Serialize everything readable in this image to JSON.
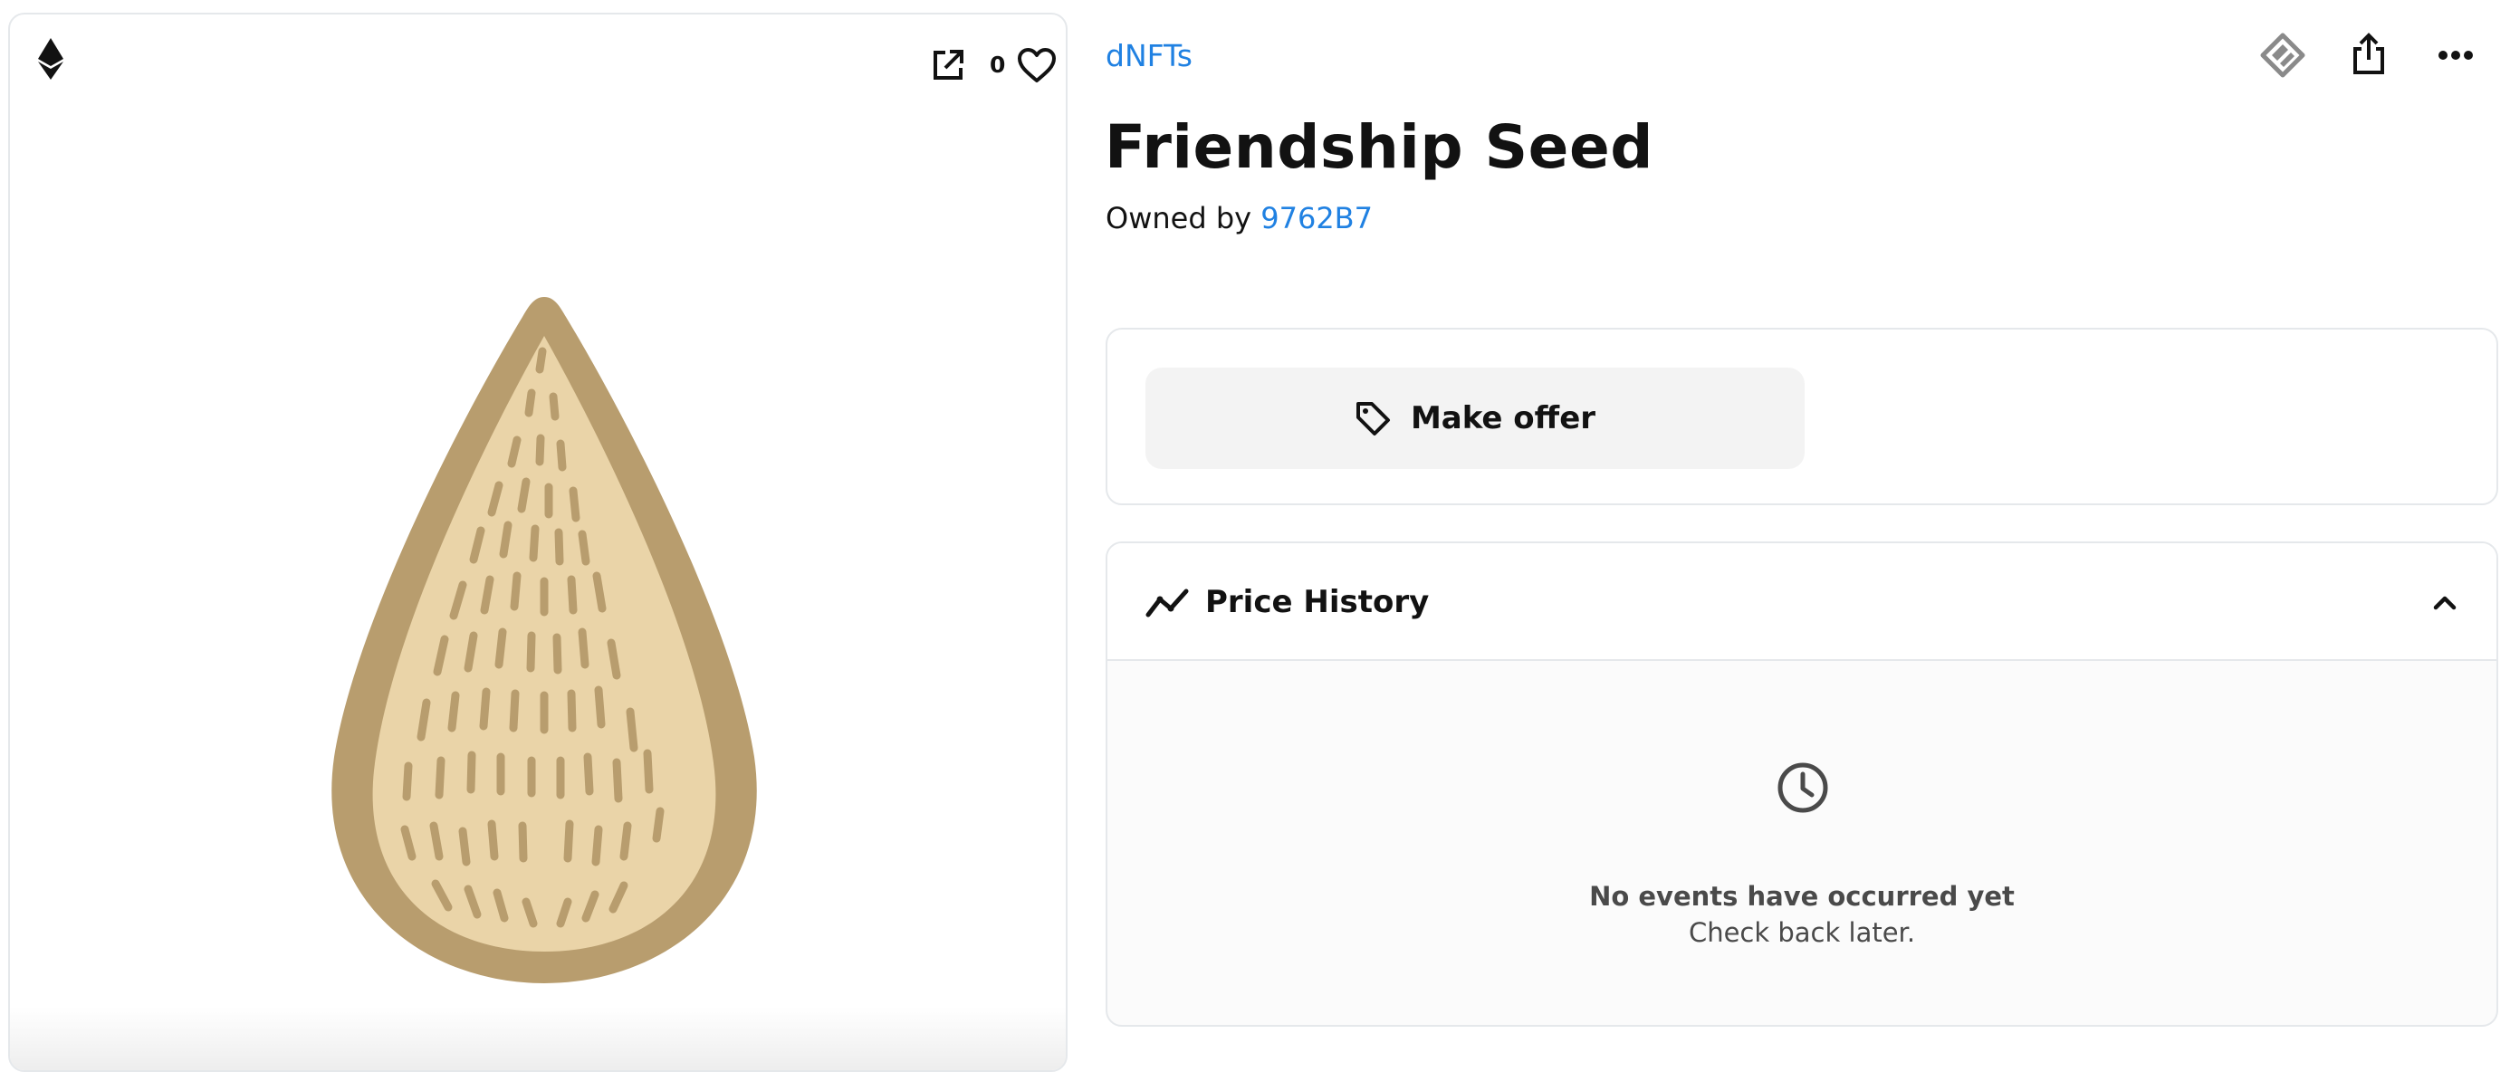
{
  "media": {
    "chain_icon": "ethereum-icon",
    "open_icon": "external-link-icon",
    "favorite_count": "0",
    "favorite_icon": "heart-outline-icon",
    "image_subject": "seed-illustration",
    "colors": {
      "seed_fill": "#ead4a8",
      "seed_outline": "#b89d6e"
    }
  },
  "item": {
    "collection": "dNFTs",
    "title": "Friendship Seed",
    "owner_prefix": "Owned by ",
    "owner": "9762B7"
  },
  "toolbar": {
    "icons": [
      "transfer-icon",
      "share-icon",
      "more-options-icon"
    ]
  },
  "offer": {
    "button_label": "Make offer",
    "button_icon": "price-tag-icon"
  },
  "price_history": {
    "title": "Price History",
    "header_icon": "trend-line-icon",
    "toggle_icon": "chevron-up-icon",
    "empty_icon": "clock-icon",
    "empty_title": "No events have occurred yet",
    "empty_subtitle": "Check back later."
  },
  "colors": {
    "link": "#2081e2",
    "border": "#e5e8eb",
    "button_bg": "#f3f3f3",
    "text": "#121212"
  }
}
